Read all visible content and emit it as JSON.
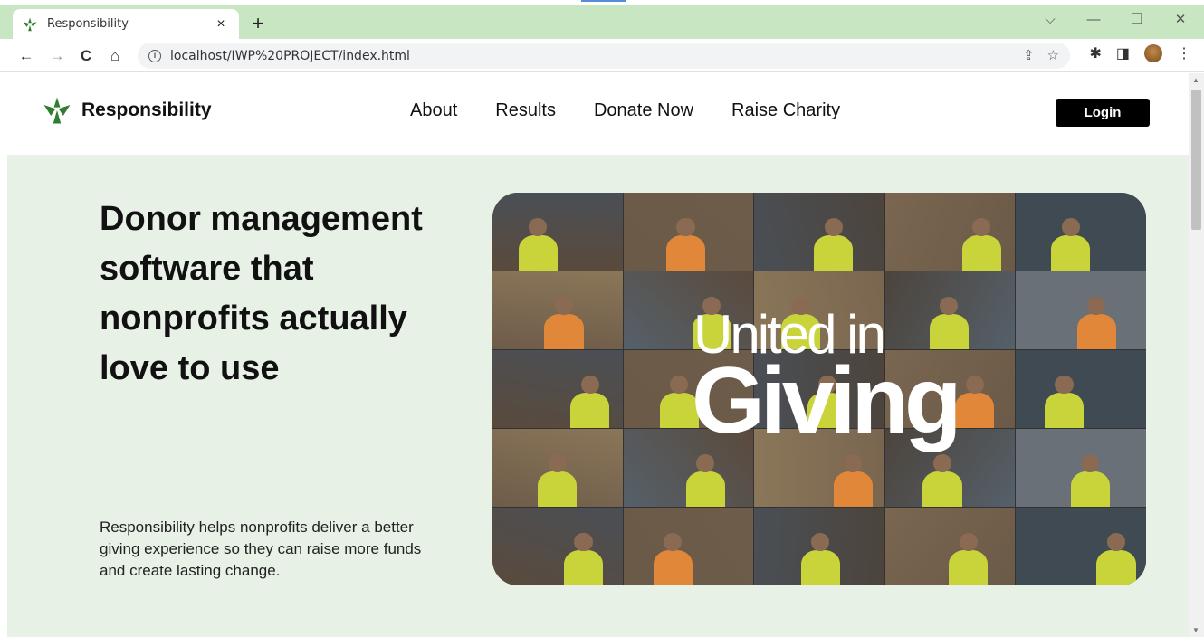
{
  "browser": {
    "tab_title": "Responsibility",
    "tab_close": "×",
    "new_tab": "+",
    "url": "localhost/IWP%20PROJECT/index.html",
    "back": "←",
    "forward": "→",
    "reload": "C",
    "home": "⌂",
    "share_icon": "⇪",
    "star_icon": "☆",
    "extensions_icon": "✱",
    "sidepanel_icon": "◨",
    "menu_icon": "⋮",
    "win_dropdown": "⌵",
    "win_min": "—",
    "win_restore": "❐",
    "win_close": "✕"
  },
  "header": {
    "brand": "Responsibility",
    "nav": [
      "About",
      "Results",
      "Donate Now",
      "Raise Charity"
    ],
    "login_label": "Login"
  },
  "hero": {
    "headline": "Donor management software that nonprofits actually love to use",
    "description": "Responsibility helps nonprofits deliver a better giving experience so they can raise more funds and create lasting change.",
    "image_text_line1": "United in",
    "image_text_line2": "Giving"
  },
  "colors": {
    "tab_bar": "#c7e6c1",
    "hero_background": "#e7f1e6",
    "logo_green": "#2e7d32",
    "login_button": "#000000"
  }
}
